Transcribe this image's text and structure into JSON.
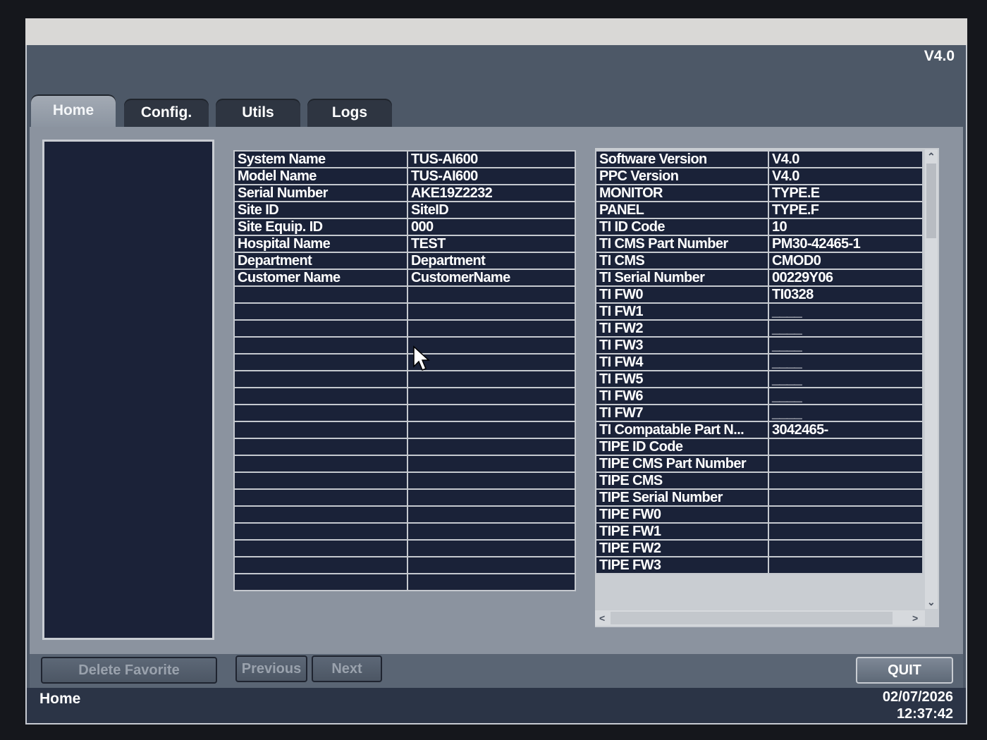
{
  "header": {
    "version": "V4.0"
  },
  "tabs": [
    {
      "label": "Home",
      "active": true
    },
    {
      "label": "Config."
    },
    {
      "label": "Utils"
    },
    {
      "label": "Logs"
    }
  ],
  "system_info": [
    {
      "key": "System Name",
      "value": "TUS-AI600"
    },
    {
      "key": "Model Name",
      "value": "TUS-AI600"
    },
    {
      "key": "Serial Number",
      "value": "AKE19Z2232"
    },
    {
      "key": "Site ID",
      "value": "SiteID"
    },
    {
      "key": "Site Equip. ID",
      "value": "000"
    },
    {
      "key": "Hospital Name",
      "value": "TEST"
    },
    {
      "key": "Department",
      "value": "Department"
    },
    {
      "key": "Customer Name",
      "value": "CustomerName"
    }
  ],
  "system_info_empty_rows": 18,
  "version_info": [
    {
      "key": "Software Version",
      "value": "V4.0"
    },
    {
      "key": "PPC Version",
      "value": "V4.0"
    },
    {
      "key": "MONITOR",
      "value": "TYPE.E"
    },
    {
      "key": "PANEL",
      "value": "TYPE.F"
    },
    {
      "key": "TI ID Code",
      "value": "10"
    },
    {
      "key": "TI CMS Part Number",
      "value": "PM30-42465-1"
    },
    {
      "key": "TI CMS",
      "value": "CMOD0"
    },
    {
      "key": "TI Serial Number",
      "value": "00229Y06"
    },
    {
      "key": "TI FW0",
      "value": "TI0328"
    },
    {
      "key": "TI FW1",
      "value": "____"
    },
    {
      "key": "TI FW2",
      "value": "____"
    },
    {
      "key": "TI FW3",
      "value": "____"
    },
    {
      "key": "TI FW4",
      "value": "____"
    },
    {
      "key": "TI FW5",
      "value": "____"
    },
    {
      "key": "TI FW6",
      "value": "____"
    },
    {
      "key": "TI FW7",
      "value": "____"
    },
    {
      "key": "TI Compatable Part N...",
      "value": "3042465-"
    },
    {
      "key": "TIPE ID Code",
      "value": ""
    },
    {
      "key": "TIPE CMS Part Number",
      "value": ""
    },
    {
      "key": "TIPE CMS",
      "value": ""
    },
    {
      "key": "TIPE Serial Number",
      "value": ""
    },
    {
      "key": "TIPE FW0",
      "value": ""
    },
    {
      "key": "TIPE FW1",
      "value": ""
    },
    {
      "key": "TIPE FW2",
      "value": ""
    },
    {
      "key": "TIPE FW3",
      "value": ""
    }
  ],
  "buttons": {
    "delete_favorite": "Delete Favorite",
    "previous": "Previous",
    "next": "Next",
    "quit": "QUIT"
  },
  "status": {
    "location": "Home",
    "date": "02/07/2026",
    "time": "12:37:42"
  }
}
